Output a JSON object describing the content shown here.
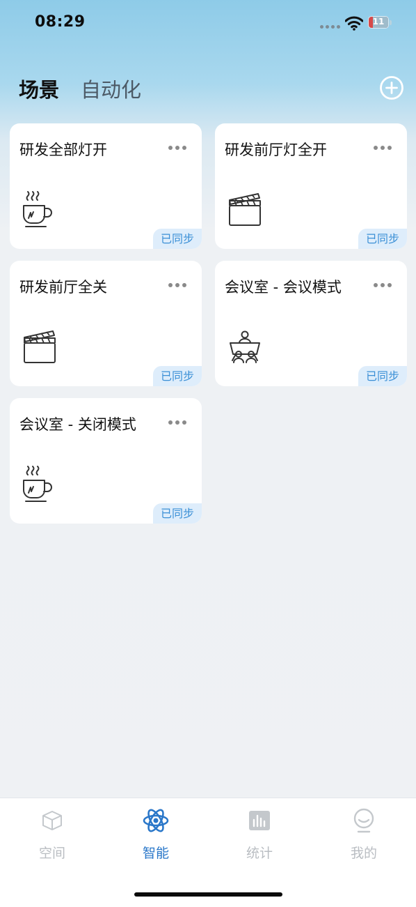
{
  "status_bar": {
    "time": "08:29",
    "battery": "11"
  },
  "header": {
    "tabs": [
      {
        "label": "场景",
        "active": true
      },
      {
        "label": "自动化",
        "active": false
      }
    ],
    "add_icon": "plus-circle-icon"
  },
  "scenes": [
    {
      "title": "研发全部灯开",
      "icon": "coffee-cup-icon",
      "badge": "已同步"
    },
    {
      "title": "研发前厅灯全开",
      "icon": "clapperboard-icon",
      "badge": "已同步"
    },
    {
      "title": "研发前厅全关",
      "icon": "clapperboard-icon",
      "badge": "已同步"
    },
    {
      "title": "会议室 - 会议模式",
      "icon": "meeting-icon",
      "badge": "已同步"
    },
    {
      "title": "会议室 - 关闭模式",
      "icon": "coffee-cup-icon",
      "badge": "已同步"
    }
  ],
  "tab_bar": {
    "items": [
      {
        "label": "空间",
        "icon": "cube-icon",
        "active": false
      },
      {
        "label": "智能",
        "icon": "atom-icon",
        "active": true
      },
      {
        "label": "统计",
        "icon": "bar-chart-icon",
        "active": false
      },
      {
        "label": "我的",
        "icon": "smiley-face-icon",
        "active": false
      }
    ]
  },
  "colors": {
    "accent": "#2a77c9",
    "badge_bg": "#deedfb",
    "badge_text": "#3a8fd6",
    "inactive_tab": "#b9bdc2"
  }
}
